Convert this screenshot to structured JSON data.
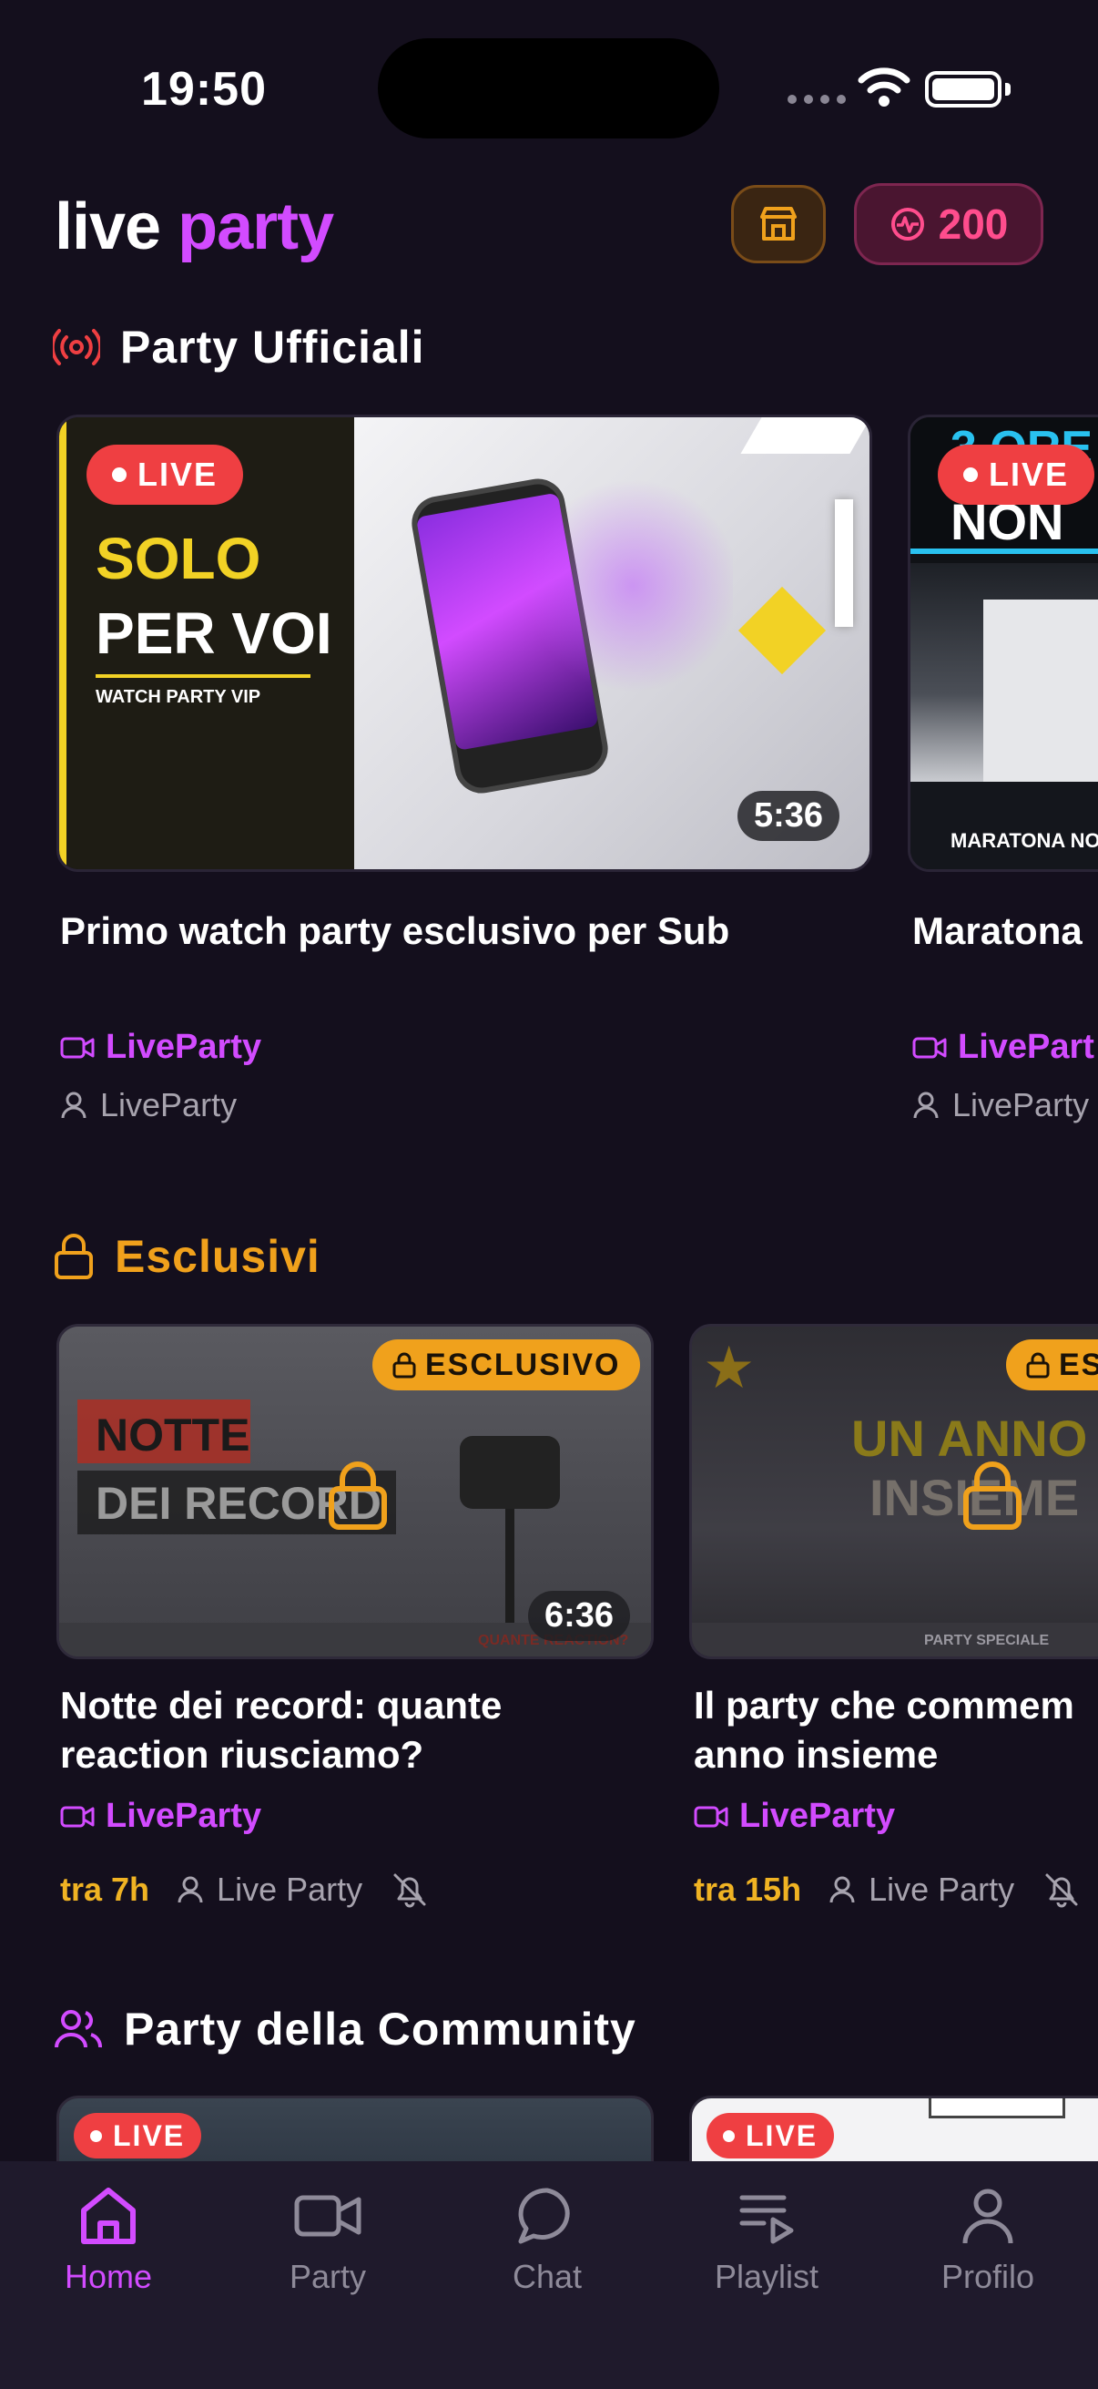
{
  "status_bar": {
    "time": "19:50"
  },
  "header": {
    "logo_part1": "live",
    "logo_part2": "party",
    "coins": "200"
  },
  "sections": {
    "official": "Party Ufficiali",
    "exclusive": "Esclusivi",
    "community": "Party della Community"
  },
  "official_cards": [
    {
      "badge": "LIVE",
      "thumb_line1": "SOLO",
      "thumb_line2": "PER VOI",
      "thumb_sub": "WATCH PARTY VIP",
      "duration": "5:36",
      "title": "Primo watch party esclusivo per Sub",
      "channel": "LiveParty",
      "host": "LiveParty"
    },
    {
      "badge": "LIVE",
      "thumb_line1": "3 ORE",
      "thumb_line2": "NON",
      "thumb_sub": "MARATONA NO",
      "title": "Maratona",
      "channel": "LivePart",
      "host": "LiveParty"
    }
  ],
  "exclusive_cards": [
    {
      "badge": "ESCLUSIVO",
      "thumb_line1": "NOTTE",
      "thumb_line2": "DEI RECORD",
      "thumb_sub": "QUANTE REACTION?",
      "duration": "6:36",
      "title_line1": "Notte dei record: quante",
      "title_line2": "reaction riusciamo?",
      "channel": "LiveParty",
      "time": "tra 7h",
      "host": "Live Party"
    },
    {
      "badge": "ES",
      "thumb_line1": "UN ANNO",
      "thumb_line2": "INSIEME",
      "thumb_sub": "PARTY SPECIALE",
      "title_line1": "Il party che commem",
      "title_line2": "anno insieme",
      "channel": "LiveParty",
      "time": "tra 15h",
      "host": "Live Party"
    }
  ],
  "community_cards": [
    {
      "badge": "LIVE"
    },
    {
      "badge": "LIVE"
    }
  ],
  "nav": [
    {
      "label": "Home",
      "icon": "home-icon"
    },
    {
      "label": "Party",
      "icon": "video-camera-icon"
    },
    {
      "label": "Chat",
      "icon": "chat-bubble-icon"
    },
    {
      "label": "Playlist",
      "icon": "playlist-icon"
    },
    {
      "label": "Profilo",
      "icon": "user-icon"
    }
  ],
  "colors": {
    "background": "#140f1d",
    "accent": "#d24bff",
    "exclusive": "#f0a11c",
    "live": "#ef3f42",
    "coins": "#ff4d8d"
  }
}
